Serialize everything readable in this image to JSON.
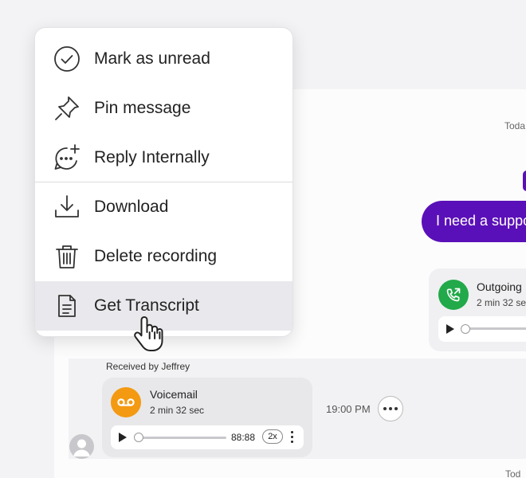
{
  "menu": {
    "items": [
      {
        "label": "Mark as unread",
        "icon": "check-circle-icon"
      },
      {
        "label": "Pin message",
        "icon": "pin-icon"
      },
      {
        "label": "Reply Internally",
        "icon": "chat-add-icon"
      },
      {
        "label": "Download",
        "icon": "download-icon"
      },
      {
        "label": "Delete recording",
        "icon": "trash-icon"
      },
      {
        "label": "Get Transcript",
        "icon": "document-icon"
      }
    ],
    "highlighted_item": "Get Transcript"
  },
  "chat": {
    "date_top": "Toda",
    "date_bottom": "Tod",
    "outgoing_message": "I need a suppo",
    "call_card": {
      "title": "Outgoing",
      "subtitle": "2 min 32 se"
    },
    "incoming": {
      "received_by": "Received by Jeffrey",
      "voicemail_title": "Voicemail",
      "voicemail_duration": "2 min 32 sec",
      "player_time": "88:88",
      "speed": "2x",
      "timestamp": "19:00 PM"
    }
  },
  "colors": {
    "accent_purple": "#5a10b8",
    "call_green": "#22a94a",
    "voicemail_orange": "#f39a12",
    "menu_highlight": "#e9e8ec"
  }
}
